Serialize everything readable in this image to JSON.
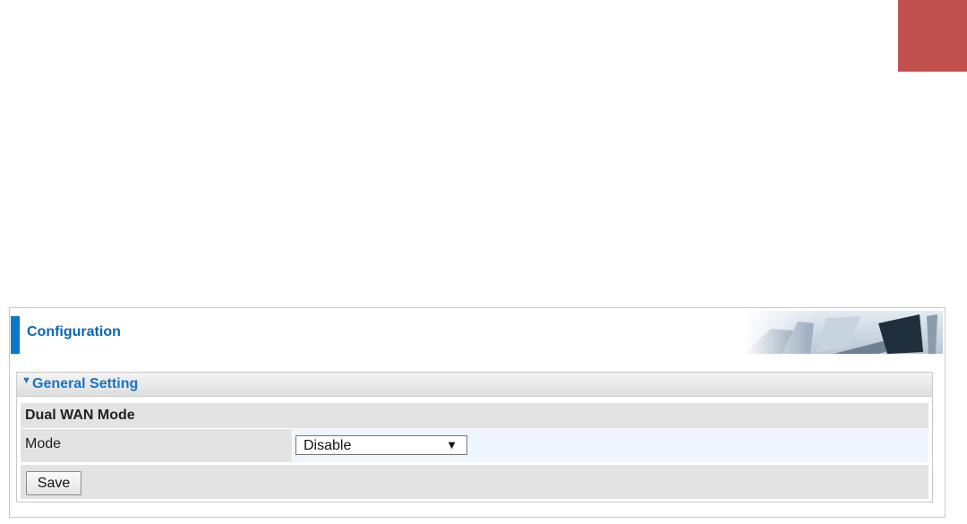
{
  "panel": {
    "title": "Configuration"
  },
  "section": {
    "title": "General Setting",
    "toggle_icon": "triangle-down-icon"
  },
  "dual_wan": {
    "heading": "Dual WAN Mode",
    "mode_label": "Mode",
    "mode_value": "Disable",
    "mode_arrow": "▼"
  },
  "actions": {
    "save_label": "Save"
  },
  "colors": {
    "corner_block": "#c0504d",
    "accent": "#0a78c8",
    "title_text": "#0a66b4",
    "section_title": "#1a74c4",
    "row_gray": "#e3e3e3",
    "row_blue": "#eef5fc"
  }
}
